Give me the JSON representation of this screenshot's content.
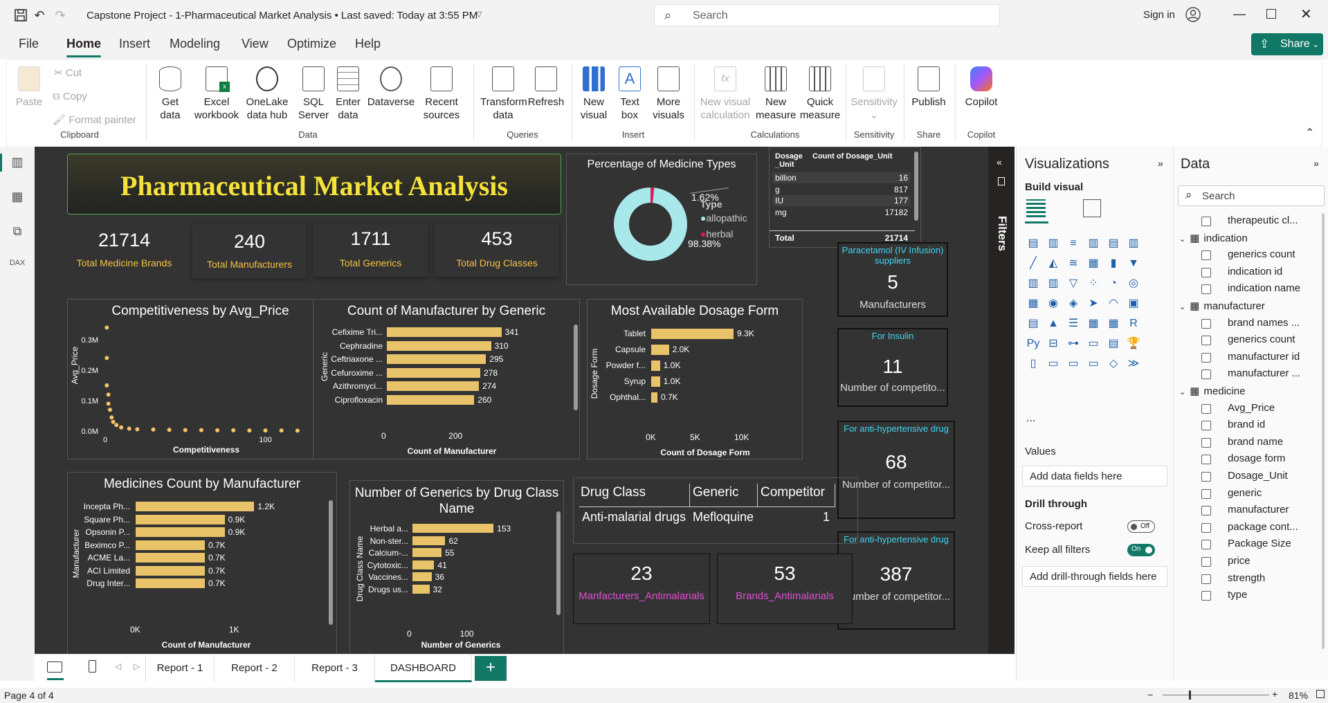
{
  "window": {
    "doc_title": "Capstone Project - 1-Pharmaceutical Market Analysis • Last saved: Today at 3:55 PM",
    "search_placeholder": "Search",
    "sign_in": "Sign in"
  },
  "menu": [
    "File",
    "Home",
    "Insert",
    "Modeling",
    "View",
    "Optimize",
    "Help"
  ],
  "share_label": "Share",
  "ribbon": {
    "clipboard": {
      "paste": "Paste",
      "cut": "Cut",
      "copy": "Copy",
      "format_painter": "Format painter",
      "label": "Clipboard"
    },
    "data": {
      "get_data_1": "Get",
      "get_data_2": "data",
      "excel_1": "Excel",
      "excel_2": "workbook",
      "onelake_1": "OneLake",
      "onelake_2": "data hub",
      "sql_1": "SQL",
      "sql_2": "Server",
      "enter_1": "Enter",
      "enter_2": "data",
      "dataverse": "Dataverse",
      "recent_1": "Recent",
      "recent_2": "sources",
      "label": "Data"
    },
    "queries": {
      "transform_1": "Transform",
      "transform_2": "data",
      "refresh": "Refresh",
      "label": "Queries"
    },
    "insert": {
      "new_visual_1": "New",
      "new_visual_2": "visual",
      "text_box_1": "Text",
      "text_box_2": "box",
      "more_1": "More",
      "more_2": "visuals",
      "label": "Insert"
    },
    "calculations": {
      "new_visual_calc_1": "New visual",
      "new_visual_calc_2": "calculation",
      "new_measure_1": "New",
      "new_measure_2": "measure",
      "quick_1": "Quick",
      "quick_2": "measure",
      "label": "Calculations"
    },
    "sensitivity": {
      "btn": "Sensitivity",
      "label": "Sensitivity"
    },
    "share": {
      "btn": "Publish",
      "label": "Share"
    },
    "copilot": {
      "btn": "Copilot",
      "label": "Copilot"
    }
  },
  "report": {
    "title": "Pharmaceutical Market Analysis",
    "kpis": [
      {
        "value": "21714",
        "label": "Total Medicine Brands"
      },
      {
        "value": "240",
        "label": "Total Manufacturers"
      },
      {
        "value": "1711",
        "label": "Total Generics"
      },
      {
        "value": "453",
        "label": "Total Drug Classes"
      }
    ],
    "donut": {
      "title": "Percentage of Medicine Types",
      "legend_title": "Type",
      "small_pct": "1.62%",
      "large_pct": "98.38%",
      "legend": [
        {
          "name": "allopathic",
          "color": "#a9e8ea"
        },
        {
          "name": "herbal",
          "color": "#e0185c"
        }
      ]
    },
    "dosage_table": {
      "headers": [
        "Dosage _Unit",
        "Count of Dosage_Unit"
      ],
      "rows": [
        [
          "billion",
          "16"
        ],
        [
          "g",
          "817"
        ],
        [
          "IU",
          "177"
        ],
        [
          "mg",
          "17182"
        ]
      ],
      "total": [
        "Total",
        "21714"
      ]
    },
    "side_cards": [
      {
        "title": "Paracetamol (IV Infusion) suppliers",
        "value": "5",
        "label": "Manufacturers"
      },
      {
        "title": "For Insulin",
        "value": "11",
        "label": "Number of competito..."
      },
      {
        "title": "For anti-hypertensive drug",
        "value": "68",
        "label": "Number of competitor..."
      },
      {
        "title": "For anti-hypertensive drug",
        "value": "387",
        "label": "Number of competitor..."
      }
    ],
    "drug_class_table": {
      "headers": [
        "Drug Class",
        "Generic",
        "Competitor"
      ],
      "row": [
        "Anti-malarial drugs",
        "Mefloquine",
        "1"
      ]
    },
    "antimalarial_cards": [
      {
        "value": "23",
        "label": "Manfacturers_Antimalarials"
      },
      {
        "value": "53",
        "label": "Brands_Antimalarials"
      }
    ]
  },
  "chart_data": [
    {
      "type": "scatter",
      "title": "Competitiveness by Avg_Price",
      "xlabel": "Competitiveness",
      "ylabel": "Avg_Price",
      "yticks": [
        "0.3M",
        "0.2M",
        "0.1M",
        "0.0M"
      ],
      "xticks": [
        "0",
        "100"
      ],
      "xlim": [
        0,
        130
      ],
      "ylim": [
        0,
        350000
      ],
      "points": [
        [
          1,
          340000
        ],
        [
          1,
          240000
        ],
        [
          1,
          150000
        ],
        [
          2,
          120000
        ],
        [
          2,
          90000
        ],
        [
          3,
          70000
        ],
        [
          4,
          45000
        ],
        [
          5,
          30000
        ],
        [
          7,
          20000
        ],
        [
          10,
          12000
        ],
        [
          15,
          8000
        ],
        [
          20,
          6000
        ],
        [
          30,
          5000
        ],
        [
          40,
          4000
        ],
        [
          50,
          3000
        ],
        [
          60,
          3000
        ],
        [
          70,
          2500
        ],
        [
          80,
          2500
        ],
        [
          90,
          2000
        ],
        [
          100,
          2000
        ],
        [
          110,
          2000
        ],
        [
          120,
          1500
        ]
      ]
    },
    {
      "type": "bar",
      "title": "Count of Manufacturer by Generic",
      "xlabel": "Count of Manufacturer",
      "ylabel": "Generic",
      "xticks": [
        "0",
        "200"
      ],
      "xlim": [
        0,
        350
      ],
      "categories": [
        "Cefixime Tri...",
        "Cephradine",
        "Ceftriaxone ...",
        "Cefuroxime ...",
        "Azithromyci...",
        "Ciprofloxacin"
      ],
      "values": [
        341,
        310,
        295,
        278,
        274,
        260
      ],
      "value_labels": [
        "341",
        "310",
        "295",
        "278",
        "274",
        "260"
      ]
    },
    {
      "type": "bar",
      "title": "Most Available Dosage Form",
      "xlabel": "Count of Dosage Form",
      "ylabel": "Dosage Form",
      "xticks": [
        "0K",
        "5K",
        "10K"
      ],
      "xlim": [
        0,
        10000
      ],
      "categories": [
        "Tablet",
        "Capsule",
        "Powder f...",
        "Syrup",
        "Ophthal..."
      ],
      "values": [
        9300,
        2000,
        1000,
        1000,
        700
      ],
      "value_labels": [
        "9.3K",
        "2.0K",
        "1.0K",
        "1.0K",
        "0.7K"
      ]
    },
    {
      "type": "bar",
      "title": "Medicines Count by Manufacturer",
      "xlabel": "Count of Manufacturer",
      "ylabel": "Manufacturer",
      "xticks": [
        "0K",
        "1K"
      ],
      "xlim": [
        0,
        1400
      ],
      "categories": [
        "Incepta Ph...",
        "Square Ph...",
        "Opsonin P...",
        "Beximco P...",
        "ACME La...",
        "ACI Limited",
        "Drug Inter..."
      ],
      "values": [
        1200,
        900,
        900,
        700,
        700,
        700,
        700
      ],
      "value_labels": [
        "1.2K",
        "0.9K",
        "0.9K",
        "0.7K",
        "0.7K",
        "0.7K",
        "0.7K"
      ]
    },
    {
      "type": "bar",
      "title": "Number of Generics by Drug Class Name",
      "xlabel": "Number of Generics",
      "ylabel": "Drug Class Name",
      "xticks": [
        "0",
        "100"
      ],
      "xlim": [
        0,
        175
      ],
      "categories": [
        "Herbal a...",
        "Non-ster...",
        "Calcium-...",
        "Cytotoxic...",
        "Vaccines...",
        "Drugs us..."
      ],
      "values": [
        153,
        62,
        55,
        41,
        36,
        32
      ],
      "value_labels": [
        "153",
        "62",
        "55",
        "41",
        "36",
        "32"
      ]
    },
    {
      "type": "pie",
      "title": "Percentage of Medicine Types",
      "categories": [
        "allopathic",
        "herbal"
      ],
      "values": [
        98.38,
        1.62
      ]
    }
  ],
  "filters_label": "Filters",
  "visualizations": {
    "title": "Visualizations",
    "build_visual": "Build visual",
    "values_label": "Values",
    "add_data_fields": "Add data fields here",
    "drill_through": "Drill through",
    "cross_report": "Cross-report",
    "cross_report_state": "Off",
    "keep_filters": "Keep all filters",
    "keep_filters_state": "On",
    "add_drill": "Add drill-through fields here",
    "more": "..."
  },
  "data_pane": {
    "title": "Data",
    "search_placeholder": "Search",
    "items": [
      {
        "text": "therapeutic cl...",
        "level": 2
      },
      {
        "text": "indication",
        "level": 1
      },
      {
        "text": "generics count",
        "level": 2
      },
      {
        "text": "indication id",
        "level": 2
      },
      {
        "text": "indication name",
        "level": 2
      },
      {
        "text": "manufacturer",
        "level": 1
      },
      {
        "text": "brand names ...",
        "level": 2
      },
      {
        "text": "generics count",
        "level": 2
      },
      {
        "text": "manufacturer id",
        "level": 2
      },
      {
        "text": "manufacturer ...",
        "level": 2
      },
      {
        "text": "medicine",
        "level": 1
      },
      {
        "text": "Avg_Price",
        "level": 2
      },
      {
        "text": "brand id",
        "level": 2
      },
      {
        "text": "brand name",
        "level": 2
      },
      {
        "text": "dosage form",
        "level": 2
      },
      {
        "text": "Dosage_Unit",
        "level": 2
      },
      {
        "text": "generic",
        "level": 2
      },
      {
        "text": "manufacturer",
        "level": 2
      },
      {
        "text": "package cont...",
        "level": 2
      },
      {
        "text": "Package Size",
        "level": 2
      },
      {
        "text": "price",
        "level": 2
      },
      {
        "text": "strength",
        "level": 2
      },
      {
        "text": "type",
        "level": 2
      }
    ]
  },
  "tabs": [
    "Report - 1",
    "Report - 2",
    "Report - 3",
    "DASHBOARD"
  ],
  "add_tab": "+",
  "status": {
    "page": "Page 4 of 4",
    "zoom": "81%"
  },
  "colors": {
    "accent": "#117865",
    "bar": "#e8c36a",
    "kpi_label": "#f5c242",
    "card_title": "#3fd6f2",
    "pink_label": "#e04fd6",
    "report_bg": "#333333",
    "title_text": "#f5e23a"
  }
}
